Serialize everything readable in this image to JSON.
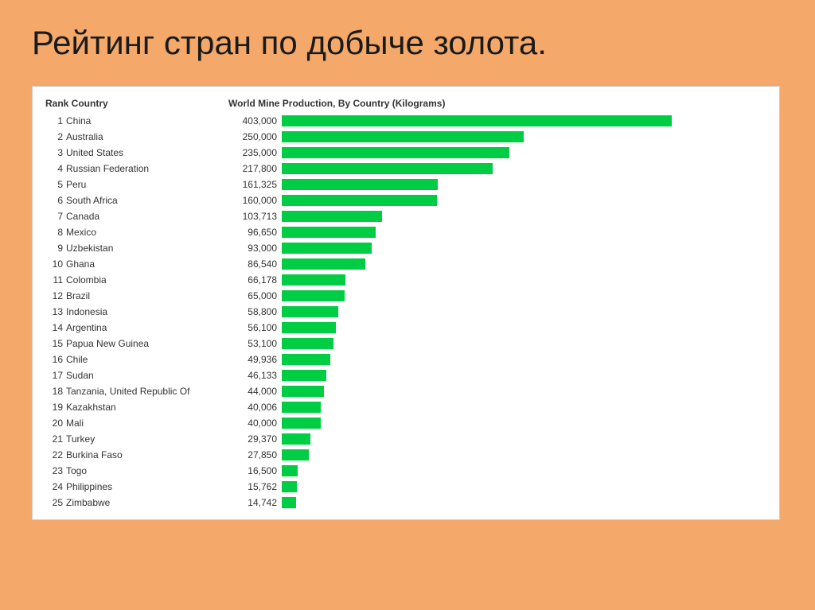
{
  "title": "Рейтинг стран по добыче золота.",
  "table": {
    "header_rank_country": "Rank Country",
    "header_production": "World Mine Production, By Country (Kilograms)",
    "max_value": 403000,
    "bar_width_scale": 500,
    "rows": [
      {
        "rank": 1,
        "country": "China",
        "value": 403000,
        "value_str": "403,000"
      },
      {
        "rank": 2,
        "country": "Australia",
        "value": 250000,
        "value_str": "250,000"
      },
      {
        "rank": 3,
        "country": "United States",
        "value": 235000,
        "value_str": "235,000"
      },
      {
        "rank": 4,
        "country": "Russian Federation",
        "value": 217800,
        "value_str": "217,800"
      },
      {
        "rank": 5,
        "country": "Peru",
        "value": 161325,
        "value_str": "161,325"
      },
      {
        "rank": 6,
        "country": "South Africa",
        "value": 160000,
        "value_str": "160,000"
      },
      {
        "rank": 7,
        "country": "Canada",
        "value": 103713,
        "value_str": "103,713"
      },
      {
        "rank": 8,
        "country": "Mexico",
        "value": 96650,
        "value_str": "96,650"
      },
      {
        "rank": 9,
        "country": "Uzbekistan",
        "value": 93000,
        "value_str": "93,000"
      },
      {
        "rank": 10,
        "country": "Ghana",
        "value": 86540,
        "value_str": "86,540"
      },
      {
        "rank": 11,
        "country": "Colombia",
        "value": 66178,
        "value_str": "66,178"
      },
      {
        "rank": 12,
        "country": "Brazil",
        "value": 65000,
        "value_str": "65,000"
      },
      {
        "rank": 13,
        "country": "Indonesia",
        "value": 58800,
        "value_str": "58,800"
      },
      {
        "rank": 14,
        "country": "Argentina",
        "value": 56100,
        "value_str": "56,100"
      },
      {
        "rank": 15,
        "country": "Papua New Guinea",
        "value": 53100,
        "value_str": "53,100"
      },
      {
        "rank": 16,
        "country": "Chile",
        "value": 49936,
        "value_str": "49,936"
      },
      {
        "rank": 17,
        "country": "Sudan",
        "value": 46133,
        "value_str": "46,133"
      },
      {
        "rank": 18,
        "country": "Tanzania, United Republic Of",
        "value": 44000,
        "value_str": "44,000"
      },
      {
        "rank": 19,
        "country": "Kazakhstan",
        "value": 40006,
        "value_str": "40,006"
      },
      {
        "rank": 20,
        "country": "Mali",
        "value": 40000,
        "value_str": "40,000"
      },
      {
        "rank": 21,
        "country": "Turkey",
        "value": 29370,
        "value_str": "29,370"
      },
      {
        "rank": 22,
        "country": "Burkina Faso",
        "value": 27850,
        "value_str": "27,850"
      },
      {
        "rank": 23,
        "country": "Togo",
        "value": 16500,
        "value_str": "16,500"
      },
      {
        "rank": 24,
        "country": "Philippines",
        "value": 15762,
        "value_str": "15,762"
      },
      {
        "rank": 25,
        "country": "Zimbabwe",
        "value": 14742,
        "value_str": "14,742"
      }
    ]
  }
}
